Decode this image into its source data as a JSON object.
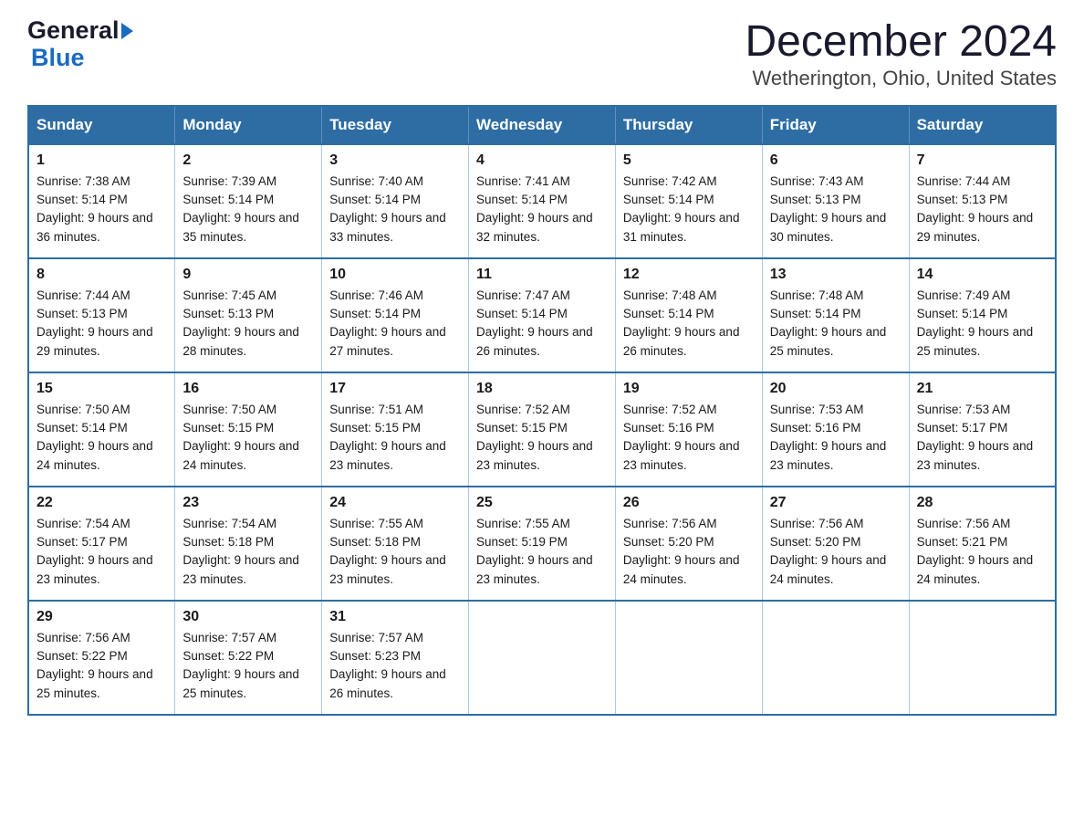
{
  "header": {
    "logo_general": "General",
    "logo_blue": "Blue",
    "month_year": "December 2024",
    "location": "Wetherington, Ohio, United States"
  },
  "days_of_week": [
    "Sunday",
    "Monday",
    "Tuesday",
    "Wednesday",
    "Thursday",
    "Friday",
    "Saturday"
  ],
  "weeks": [
    [
      {
        "day": "1",
        "sunrise": "7:38 AM",
        "sunset": "5:14 PM",
        "daylight": "9 hours and 36 minutes."
      },
      {
        "day": "2",
        "sunrise": "7:39 AM",
        "sunset": "5:14 PM",
        "daylight": "9 hours and 35 minutes."
      },
      {
        "day": "3",
        "sunrise": "7:40 AM",
        "sunset": "5:14 PM",
        "daylight": "9 hours and 33 minutes."
      },
      {
        "day": "4",
        "sunrise": "7:41 AM",
        "sunset": "5:14 PM",
        "daylight": "9 hours and 32 minutes."
      },
      {
        "day": "5",
        "sunrise": "7:42 AM",
        "sunset": "5:14 PM",
        "daylight": "9 hours and 31 minutes."
      },
      {
        "day": "6",
        "sunrise": "7:43 AM",
        "sunset": "5:13 PM",
        "daylight": "9 hours and 30 minutes."
      },
      {
        "day": "7",
        "sunrise": "7:44 AM",
        "sunset": "5:13 PM",
        "daylight": "9 hours and 29 minutes."
      }
    ],
    [
      {
        "day": "8",
        "sunrise": "7:44 AM",
        "sunset": "5:13 PM",
        "daylight": "9 hours and 29 minutes."
      },
      {
        "day": "9",
        "sunrise": "7:45 AM",
        "sunset": "5:13 PM",
        "daylight": "9 hours and 28 minutes."
      },
      {
        "day": "10",
        "sunrise": "7:46 AM",
        "sunset": "5:14 PM",
        "daylight": "9 hours and 27 minutes."
      },
      {
        "day": "11",
        "sunrise": "7:47 AM",
        "sunset": "5:14 PM",
        "daylight": "9 hours and 26 minutes."
      },
      {
        "day": "12",
        "sunrise": "7:48 AM",
        "sunset": "5:14 PM",
        "daylight": "9 hours and 26 minutes."
      },
      {
        "day": "13",
        "sunrise": "7:48 AM",
        "sunset": "5:14 PM",
        "daylight": "9 hours and 25 minutes."
      },
      {
        "day": "14",
        "sunrise": "7:49 AM",
        "sunset": "5:14 PM",
        "daylight": "9 hours and 25 minutes."
      }
    ],
    [
      {
        "day": "15",
        "sunrise": "7:50 AM",
        "sunset": "5:14 PM",
        "daylight": "9 hours and 24 minutes."
      },
      {
        "day": "16",
        "sunrise": "7:50 AM",
        "sunset": "5:15 PM",
        "daylight": "9 hours and 24 minutes."
      },
      {
        "day": "17",
        "sunrise": "7:51 AM",
        "sunset": "5:15 PM",
        "daylight": "9 hours and 23 minutes."
      },
      {
        "day": "18",
        "sunrise": "7:52 AM",
        "sunset": "5:15 PM",
        "daylight": "9 hours and 23 minutes."
      },
      {
        "day": "19",
        "sunrise": "7:52 AM",
        "sunset": "5:16 PM",
        "daylight": "9 hours and 23 minutes."
      },
      {
        "day": "20",
        "sunrise": "7:53 AM",
        "sunset": "5:16 PM",
        "daylight": "9 hours and 23 minutes."
      },
      {
        "day": "21",
        "sunrise": "7:53 AM",
        "sunset": "5:17 PM",
        "daylight": "9 hours and 23 minutes."
      }
    ],
    [
      {
        "day": "22",
        "sunrise": "7:54 AM",
        "sunset": "5:17 PM",
        "daylight": "9 hours and 23 minutes."
      },
      {
        "day": "23",
        "sunrise": "7:54 AM",
        "sunset": "5:18 PM",
        "daylight": "9 hours and 23 minutes."
      },
      {
        "day": "24",
        "sunrise": "7:55 AM",
        "sunset": "5:18 PM",
        "daylight": "9 hours and 23 minutes."
      },
      {
        "day": "25",
        "sunrise": "7:55 AM",
        "sunset": "5:19 PM",
        "daylight": "9 hours and 23 minutes."
      },
      {
        "day": "26",
        "sunrise": "7:56 AM",
        "sunset": "5:20 PM",
        "daylight": "9 hours and 24 minutes."
      },
      {
        "day": "27",
        "sunrise": "7:56 AM",
        "sunset": "5:20 PM",
        "daylight": "9 hours and 24 minutes."
      },
      {
        "day": "28",
        "sunrise": "7:56 AM",
        "sunset": "5:21 PM",
        "daylight": "9 hours and 24 minutes."
      }
    ],
    [
      {
        "day": "29",
        "sunrise": "7:56 AM",
        "sunset": "5:22 PM",
        "daylight": "9 hours and 25 minutes."
      },
      {
        "day": "30",
        "sunrise": "7:57 AM",
        "sunset": "5:22 PM",
        "daylight": "9 hours and 25 minutes."
      },
      {
        "day": "31",
        "sunrise": "7:57 AM",
        "sunset": "5:23 PM",
        "daylight": "9 hours and 26 minutes."
      },
      null,
      null,
      null,
      null
    ]
  ],
  "labels": {
    "sunrise": "Sunrise: ",
    "sunset": "Sunset: ",
    "daylight": "Daylight: "
  }
}
